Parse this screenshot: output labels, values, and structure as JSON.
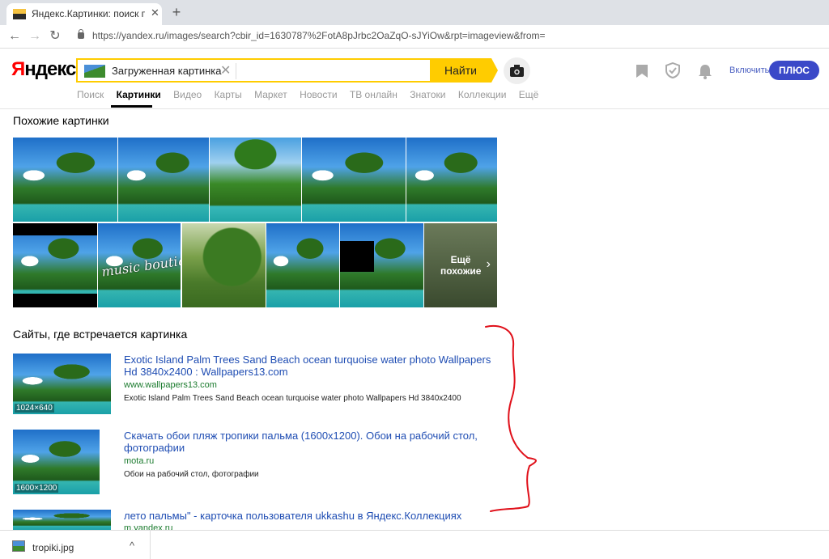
{
  "browser": {
    "tab_title": "Яндекс.Картинки: поиск по кар",
    "tab_close": "✕",
    "new_tab": "+",
    "back": "←",
    "forward": "→",
    "reload": "↻",
    "url": "https://yandex.ru/images/search?cbir_id=1630787%2FotA8pJrbc2OaZqO-sJYiOw&rpt=imageview&from="
  },
  "header": {
    "logo_first": "Я",
    "logo_rest": "ндекс",
    "search_value": "Загруженная картинка",
    "clear": "✕",
    "find_label": "Найти",
    "enable_label": "Включить",
    "plus_label": "ПЛЮС"
  },
  "nav": {
    "items": [
      "Поиск",
      "Картинки",
      "Видео",
      "Карты",
      "Маркет",
      "Новости",
      "ТВ онлайн",
      "Знатоки",
      "Коллекции",
      "Ещё"
    ],
    "active": "Картинки"
  },
  "similar": {
    "heading": "Похожие картинки",
    "watermark": "music boutique",
    "more_label_1": "Ещё",
    "more_label_2": "похожие",
    "more_chevron": "›"
  },
  "sites": {
    "heading": "Сайты, где встречается картинка",
    "results": [
      {
        "title_line1": "Exotic Island Palm Trees Sand Beach ocean turquoise water photo Wallpapers",
        "title_line2": "Hd 3840x2400 : Wallpapers13.com",
        "domain": "www.wallpapers13.com",
        "desc": "Exotic Island Palm Trees Sand Beach ocean turquoise water photo Wallpapers Hd 3840x2400",
        "size": "1024×640"
      },
      {
        "title_line1": "Скачать обои пляж тропики пальма (1600x1200). Обои на рабочий стол,",
        "title_line2": "фотографии",
        "domain": "mota.ru",
        "desc": "Обои на рабочий стол, фотографии",
        "size": "1600×1200"
      },
      {
        "title_line1": "лето пальмы\" - карточка пользователя ukkashu в Яндекс.Коллекциях",
        "domain": "m.yandex.ru"
      }
    ]
  },
  "downloads": {
    "file_name": "tropiki.jpg",
    "caret": "^"
  }
}
